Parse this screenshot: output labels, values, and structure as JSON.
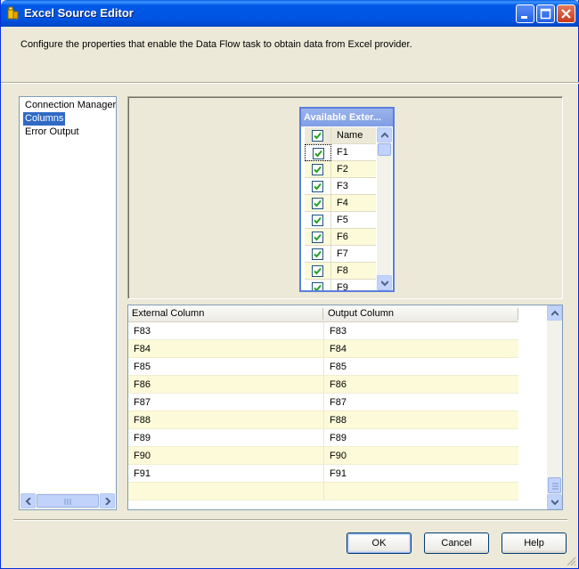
{
  "window": {
    "title": "Excel Source Editor"
  },
  "instruction": "Configure the properties that enable the Data Flow task to obtain data from Excel provider.",
  "nav": {
    "items": [
      {
        "label": "Connection Manager",
        "selected": false
      },
      {
        "label": "Columns",
        "selected": true
      },
      {
        "label": "Error Output",
        "selected": false
      }
    ]
  },
  "available_columns": {
    "title": "Available Exter...",
    "header": "Name",
    "rows": [
      "F1",
      "F2",
      "F3",
      "F4",
      "F5",
      "F6",
      "F7",
      "F8",
      "F9"
    ]
  },
  "mapping_grid": {
    "headers": [
      "External Column",
      "Output Column"
    ],
    "rows": [
      [
        "F83",
        "F83"
      ],
      [
        "F84",
        "F84"
      ],
      [
        "F85",
        "F85"
      ],
      [
        "F86",
        "F86"
      ],
      [
        "F87",
        "F87"
      ],
      [
        "F88",
        "F88"
      ],
      [
        "F89",
        "F89"
      ],
      [
        "F90",
        "F90"
      ],
      [
        "F91",
        "F91"
      ],
      [
        "",
        ""
      ]
    ]
  },
  "buttons": {
    "ok": "OK",
    "cancel": "Cancel",
    "help": "Help"
  },
  "colors": {
    "title_bar": "#0054e3",
    "selection": "#316ac5",
    "check": "#21a121",
    "alt_row": "#fcfad9"
  }
}
